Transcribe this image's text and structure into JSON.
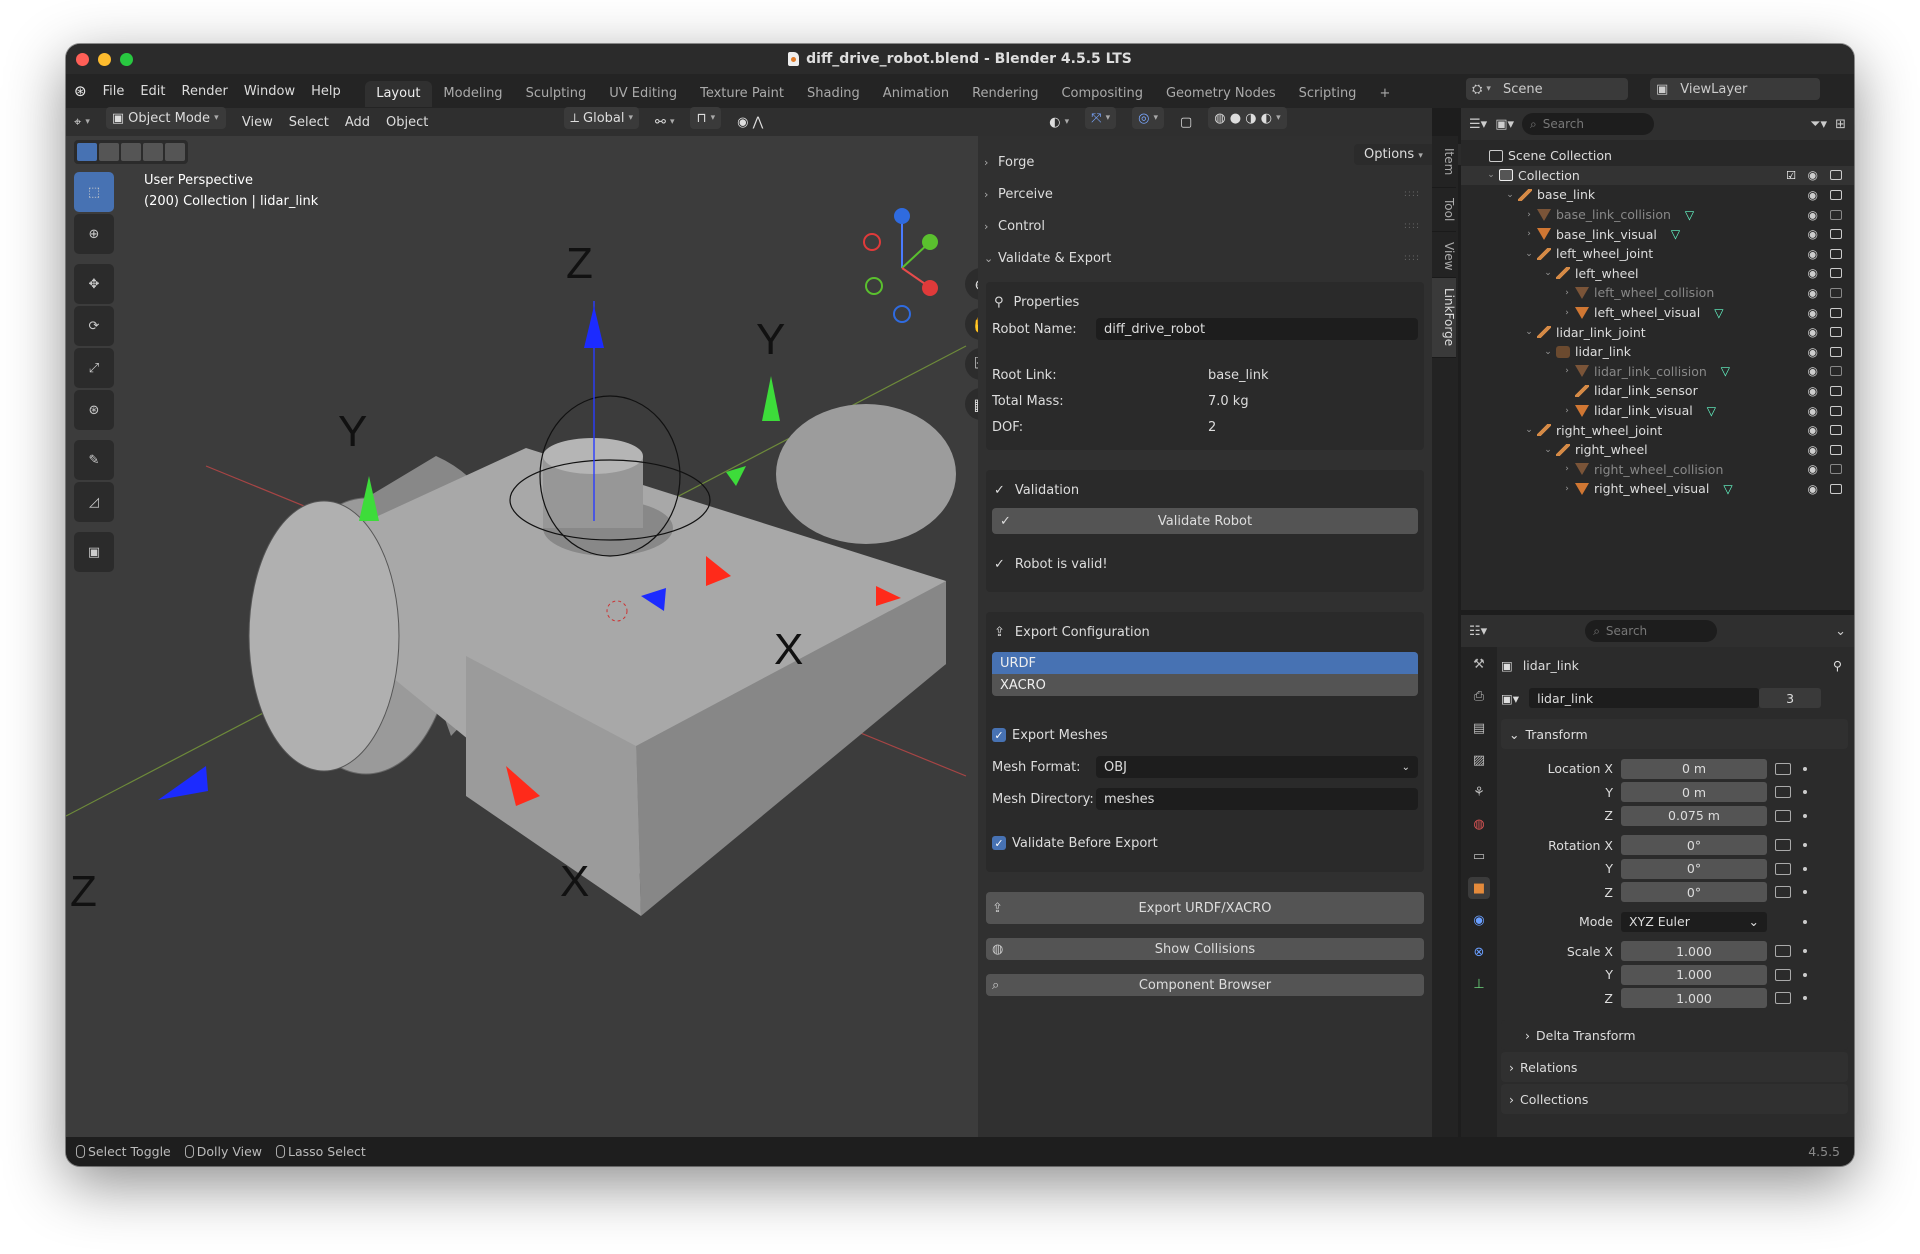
{
  "window": {
    "title": "diff_drive_robot.blend - Blender 4.5.5 LTS"
  },
  "menu": {
    "items": [
      "File",
      "Edit",
      "Render",
      "Window",
      "Help"
    ]
  },
  "workspaces": [
    "Layout",
    "Modeling",
    "Sculpting",
    "UV Editing",
    "Texture Paint",
    "Shading",
    "Animation",
    "Rendering",
    "Compositing",
    "Geometry Nodes",
    "Scripting"
  ],
  "scene": {
    "label": "Scene",
    "view_layer": "ViewLayer"
  },
  "viewport_header": {
    "mode": "Object Mode",
    "menus": [
      "View",
      "Select",
      "Add",
      "Object"
    ],
    "transform": "Global",
    "options": "Options"
  },
  "viewport": {
    "perspective": "User Perspective",
    "context": "(200) Collection | lidar_link"
  },
  "npanel": {
    "tabs": [
      "Item",
      "Tool",
      "View",
      "LinkForge"
    ],
    "sections": [
      "Forge",
      "Perceive",
      "Control",
      "Validate & Export"
    ],
    "properties": {
      "title": "Properties",
      "robot_name_label": "Robot Name:",
      "robot_name": "diff_drive_robot",
      "root_link_label": "Root Link:",
      "root_link": "base_link",
      "total_mass_label": "Total Mass:",
      "total_mass": "7.0 kg",
      "dof_label": "DOF:",
      "dof": "2"
    },
    "validation": {
      "title": "Validation",
      "button": "Validate Robot",
      "status": "Robot is valid!"
    },
    "export": {
      "title": "Export Configuration",
      "formats": [
        "URDF",
        "XACRO"
      ],
      "selected_format": "URDF",
      "export_meshes": "Export Meshes",
      "mesh_format_label": "Mesh Format:",
      "mesh_format": "OBJ",
      "mesh_dir_label": "Mesh Directory:",
      "mesh_dir": "meshes",
      "validate_before": "Validate Before Export",
      "export_button": "Export URDF/XACRO",
      "show_collisions": "Show Collisions",
      "component_browser": "Component Browser"
    }
  },
  "outliner": {
    "search_placeholder": "Search",
    "scene_collection": "Scene Collection",
    "collection": "Collection",
    "items": [
      {
        "name": "base_link",
        "dim": false
      },
      {
        "name": "base_link_collision",
        "dim": true
      },
      {
        "name": "base_link_visual",
        "dim": false
      },
      {
        "name": "left_wheel_joint",
        "dim": false
      },
      {
        "name": "left_wheel",
        "dim": false
      },
      {
        "name": "left_wheel_collision",
        "dim": true
      },
      {
        "name": "left_wheel_visual",
        "dim": false
      },
      {
        "name": "lidar_link_joint",
        "dim": false
      },
      {
        "name": "lidar_link",
        "dim": false
      },
      {
        "name": "lidar_link_collision",
        "dim": true
      },
      {
        "name": "lidar_link_sensor",
        "dim": false
      },
      {
        "name": "lidar_link_visual",
        "dim": false
      },
      {
        "name": "right_wheel_joint",
        "dim": false
      },
      {
        "name": "right_wheel",
        "dim": false
      },
      {
        "name": "right_wheel_collision",
        "dim": true
      },
      {
        "name": "right_wheel_visual",
        "dim": false
      }
    ]
  },
  "properties": {
    "search_placeholder": "Search",
    "object_name": "lidar_link",
    "data_name": "lidar_link",
    "users": "3",
    "transform": "Transform",
    "location_label": "Location X",
    "y": "Y",
    "z": "Z",
    "location": [
      "0 m",
      "0 m",
      "0.075 m"
    ],
    "rotation_label": "Rotation X",
    "rotation": [
      "0°",
      "0°",
      "0°"
    ],
    "mode_label": "Mode",
    "mode": "XYZ Euler",
    "scale_label": "Scale X",
    "scale": [
      "1.000",
      "1.000",
      "1.000"
    ],
    "delta": "Delta Transform",
    "relations": "Relations",
    "collections": "Collections"
  },
  "status": {
    "select_toggle": "Select Toggle",
    "dolly": "Dolly View",
    "lasso": "Lasso Select",
    "version": "4.5.5"
  }
}
